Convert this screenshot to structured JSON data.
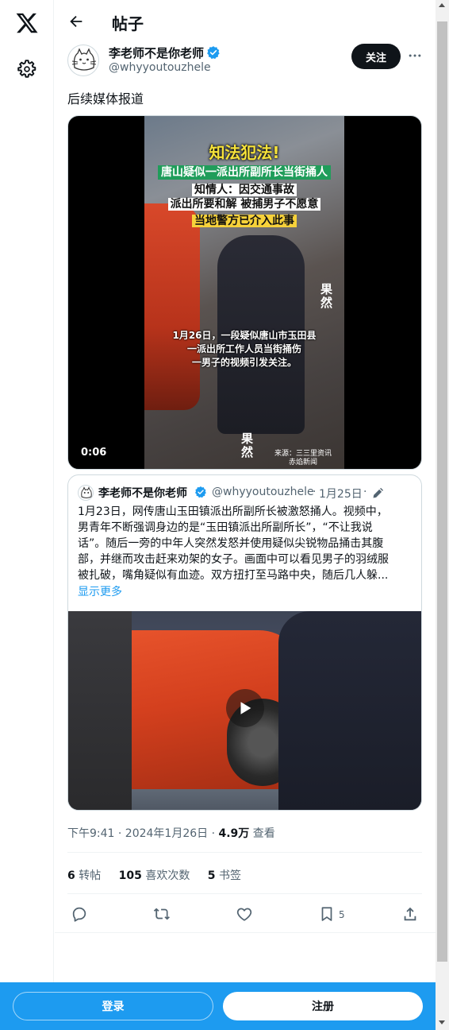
{
  "header": {
    "title": "帖子"
  },
  "author": {
    "name": "李老师不是你老师",
    "handle": "@whyyoutouzhele",
    "follow_label": "关注"
  },
  "post": {
    "text": "后续媒体报道"
  },
  "video": {
    "duration": "0:06",
    "overlay": {
      "line1": "知法犯法!",
      "line2": "唐山疑似一派出所副所长当街捅人",
      "line3": "知情人：因交通事故",
      "line4": "派出所要和解 被捕男子不愿意",
      "line5": "当地警方已介入此事",
      "caption1": "1月26日，一段疑似唐山市玉田县",
      "caption2": "一派出所工作人员当街捅伤",
      "caption3": "一男子的视频引发关注。",
      "watermark": "果然",
      "source1": "来源：三三里资讯",
      "source2": "赤焰新闻"
    }
  },
  "quote": {
    "name": "李老师不是你老师",
    "handle": "@whyyoutouzhele",
    "separator": "·",
    "date": "1月25日",
    "lines": [
      "1月23日，网传唐山玉田镇派出所副所长被激怒捅人。视频中，",
      "男青年不断强调身边的是“玉田镇派出所副所长”，“不让我说",
      "话”。随后一旁的中年人突然发怒并使用疑似尖锐物品捅击其腹",
      "部，并继而攻击赶来劝架的女子。画面中可以看见男子的羽绒服",
      "被扎破，嘴角疑似有血迹。双方扭打至马路中央，随后几人躲..."
    ],
    "show_more": "显示更多"
  },
  "meta": {
    "time": "下午9:41 · 2024年1月26日 · ",
    "views": "4.9万",
    "views_label": " 查看"
  },
  "stats": {
    "reposts": "6",
    "reposts_label": "转帖",
    "likes": "105",
    "likes_label": "喜欢次数",
    "bookmarks": "5",
    "bookmarks_label": "书签"
  },
  "actions": {
    "bookmark_count": "5"
  },
  "bottom": {
    "login": "登录",
    "signup": "注册"
  },
  "colors": {
    "accent": "#1d9bf0",
    "text": "#0f1419",
    "muted": "#536471"
  }
}
